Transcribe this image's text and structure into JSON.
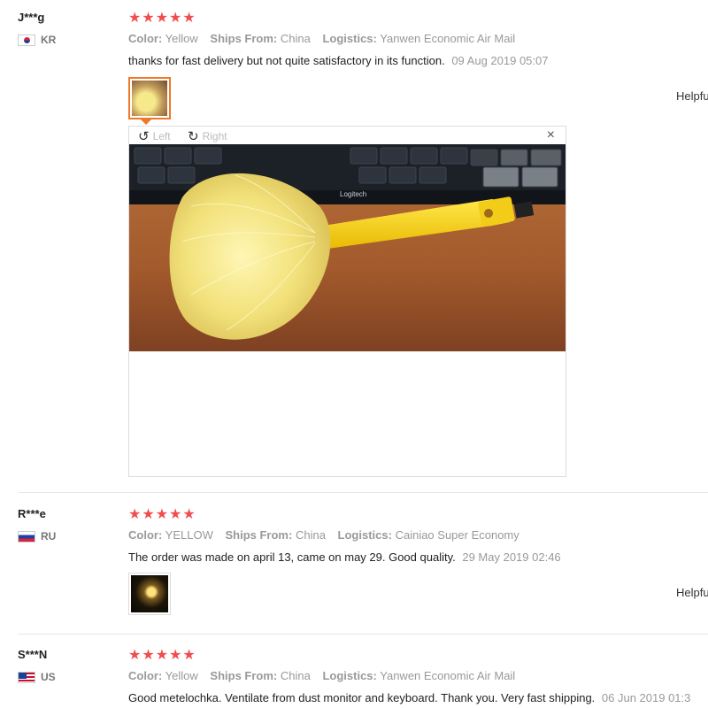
{
  "reviews": [
    {
      "user": "J***g",
      "country": "KR",
      "color_label": "Color:",
      "color": "Yellow",
      "ships_label": "Ships From:",
      "ships": "China",
      "logistics_label": "Logistics:",
      "logistics": "Yanwen Economic Air Mail",
      "text": "thanks for fast delivery but not quite satisfactory in its function.",
      "date": "09 Aug 2019 05:07",
      "helpful": "Helpfu"
    },
    {
      "user": "R***e",
      "country": "RU",
      "color_label": "Color:",
      "color": "YELLOW",
      "ships_label": "Ships From:",
      "ships": "China",
      "logistics_label": "Logistics:",
      "logistics": "Cainiao Super Economy",
      "text": "The order was made on april 13, came on may 29. Good quality.",
      "date": "29 May 2019 02:46",
      "helpful": "Helpfu"
    },
    {
      "user": "S***N",
      "country": "US",
      "color_label": "Color:",
      "color": "Yellow",
      "ships_label": "Ships From:",
      "ships": "China",
      "logistics_label": "Logistics:",
      "logistics": "Yanwen Economic Air Mail",
      "text": "Good metelochka. Ventilate from dust monitor and keyboard. Thank you. Very fast shipping.",
      "date": "06 Jun 2019 01:3"
    }
  ],
  "stars": "★★★★★",
  "viewer": {
    "rotate_left": "Left",
    "rotate_right": "Right",
    "rotate_left_icon": "↺",
    "rotate_right_icon": "↻",
    "close_icon": "×",
    "photo_label": "Logitech"
  }
}
